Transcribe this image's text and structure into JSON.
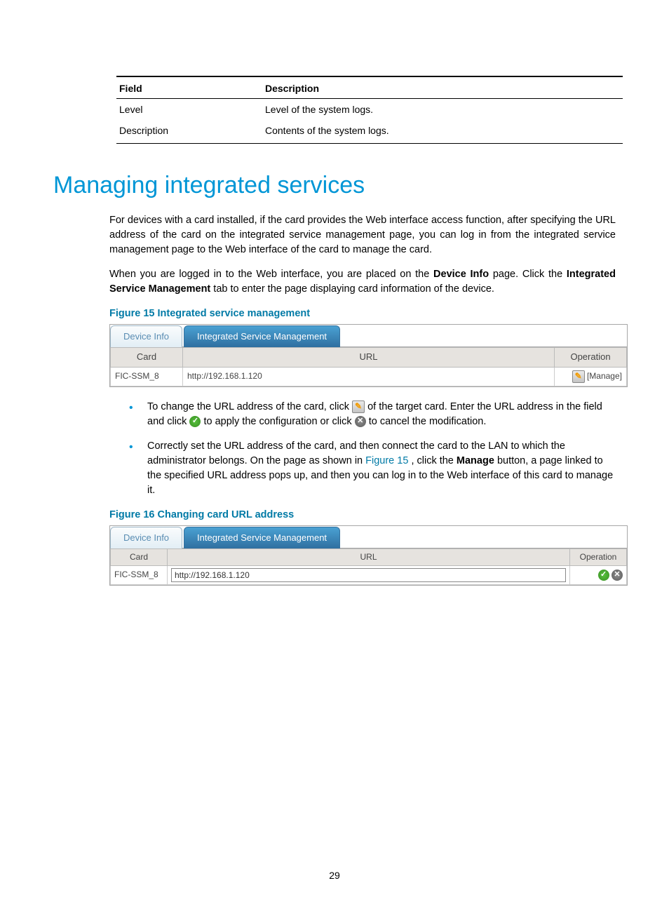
{
  "field_table": {
    "header_field": "Field",
    "header_desc": "Description",
    "rows": [
      {
        "field": "Level",
        "desc": "Level of the system logs."
      },
      {
        "field": "Description",
        "desc": "Contents of the system logs."
      }
    ]
  },
  "heading": "Managing integrated services",
  "para1": "For devices with a card installed, if the card provides the Web interface access function, after specifying the URL address of the card on the integrated service management page, you can log in from the integrated service management page to the Web interface of the card to manage the card.",
  "para2_pre": "When you are logged in to the Web interface, you are placed on the ",
  "para2_b1": "Device Info",
  "para2_mid": " page. Click the ",
  "para2_b2": "Integrated Service Management",
  "para2_end": " tab to enter the page displaying card information of the device.",
  "fig15_caption": "Figure 15 Integrated service management",
  "fig15": {
    "tab_inactive": "Device Info",
    "tab_active": "Integrated Service Management",
    "col_card": "Card",
    "col_url": "URL",
    "col_op": "Operation",
    "row_card": "FIC-SSM_8",
    "row_url": "http://192.168.1.120",
    "manage": "[Manage]"
  },
  "bullet1_pre": "To change the URL address of the card, click ",
  "bullet1_mid1": " of the target card. Enter the URL address in the field and click ",
  "bullet1_mid2": " to apply the configuration or click ",
  "bullet1_end": " to cancel the modification.",
  "bullet2_pre": "Correctly set the URL address of the card, and then connect the card to the LAN to which the administrator belongs. On the page as shown in ",
  "bullet2_figlink": "Figure 15",
  "bullet2_mid": ", click the ",
  "bullet2_b": "Manage",
  "bullet2_end": " button, a page linked to the specified URL address pops up, and then you can log in to the Web interface of this card to manage it.",
  "fig16_caption": "Figure 16 Changing card URL address",
  "fig16": {
    "tab_inactive": "Device Info",
    "tab_active": "Integrated Service Management",
    "col_card": "Card",
    "col_url": "URL",
    "col_op": "Operation",
    "row_card": "FIC-SSM_8",
    "row_url": "http://192.168.1.120"
  },
  "page_number": "29"
}
